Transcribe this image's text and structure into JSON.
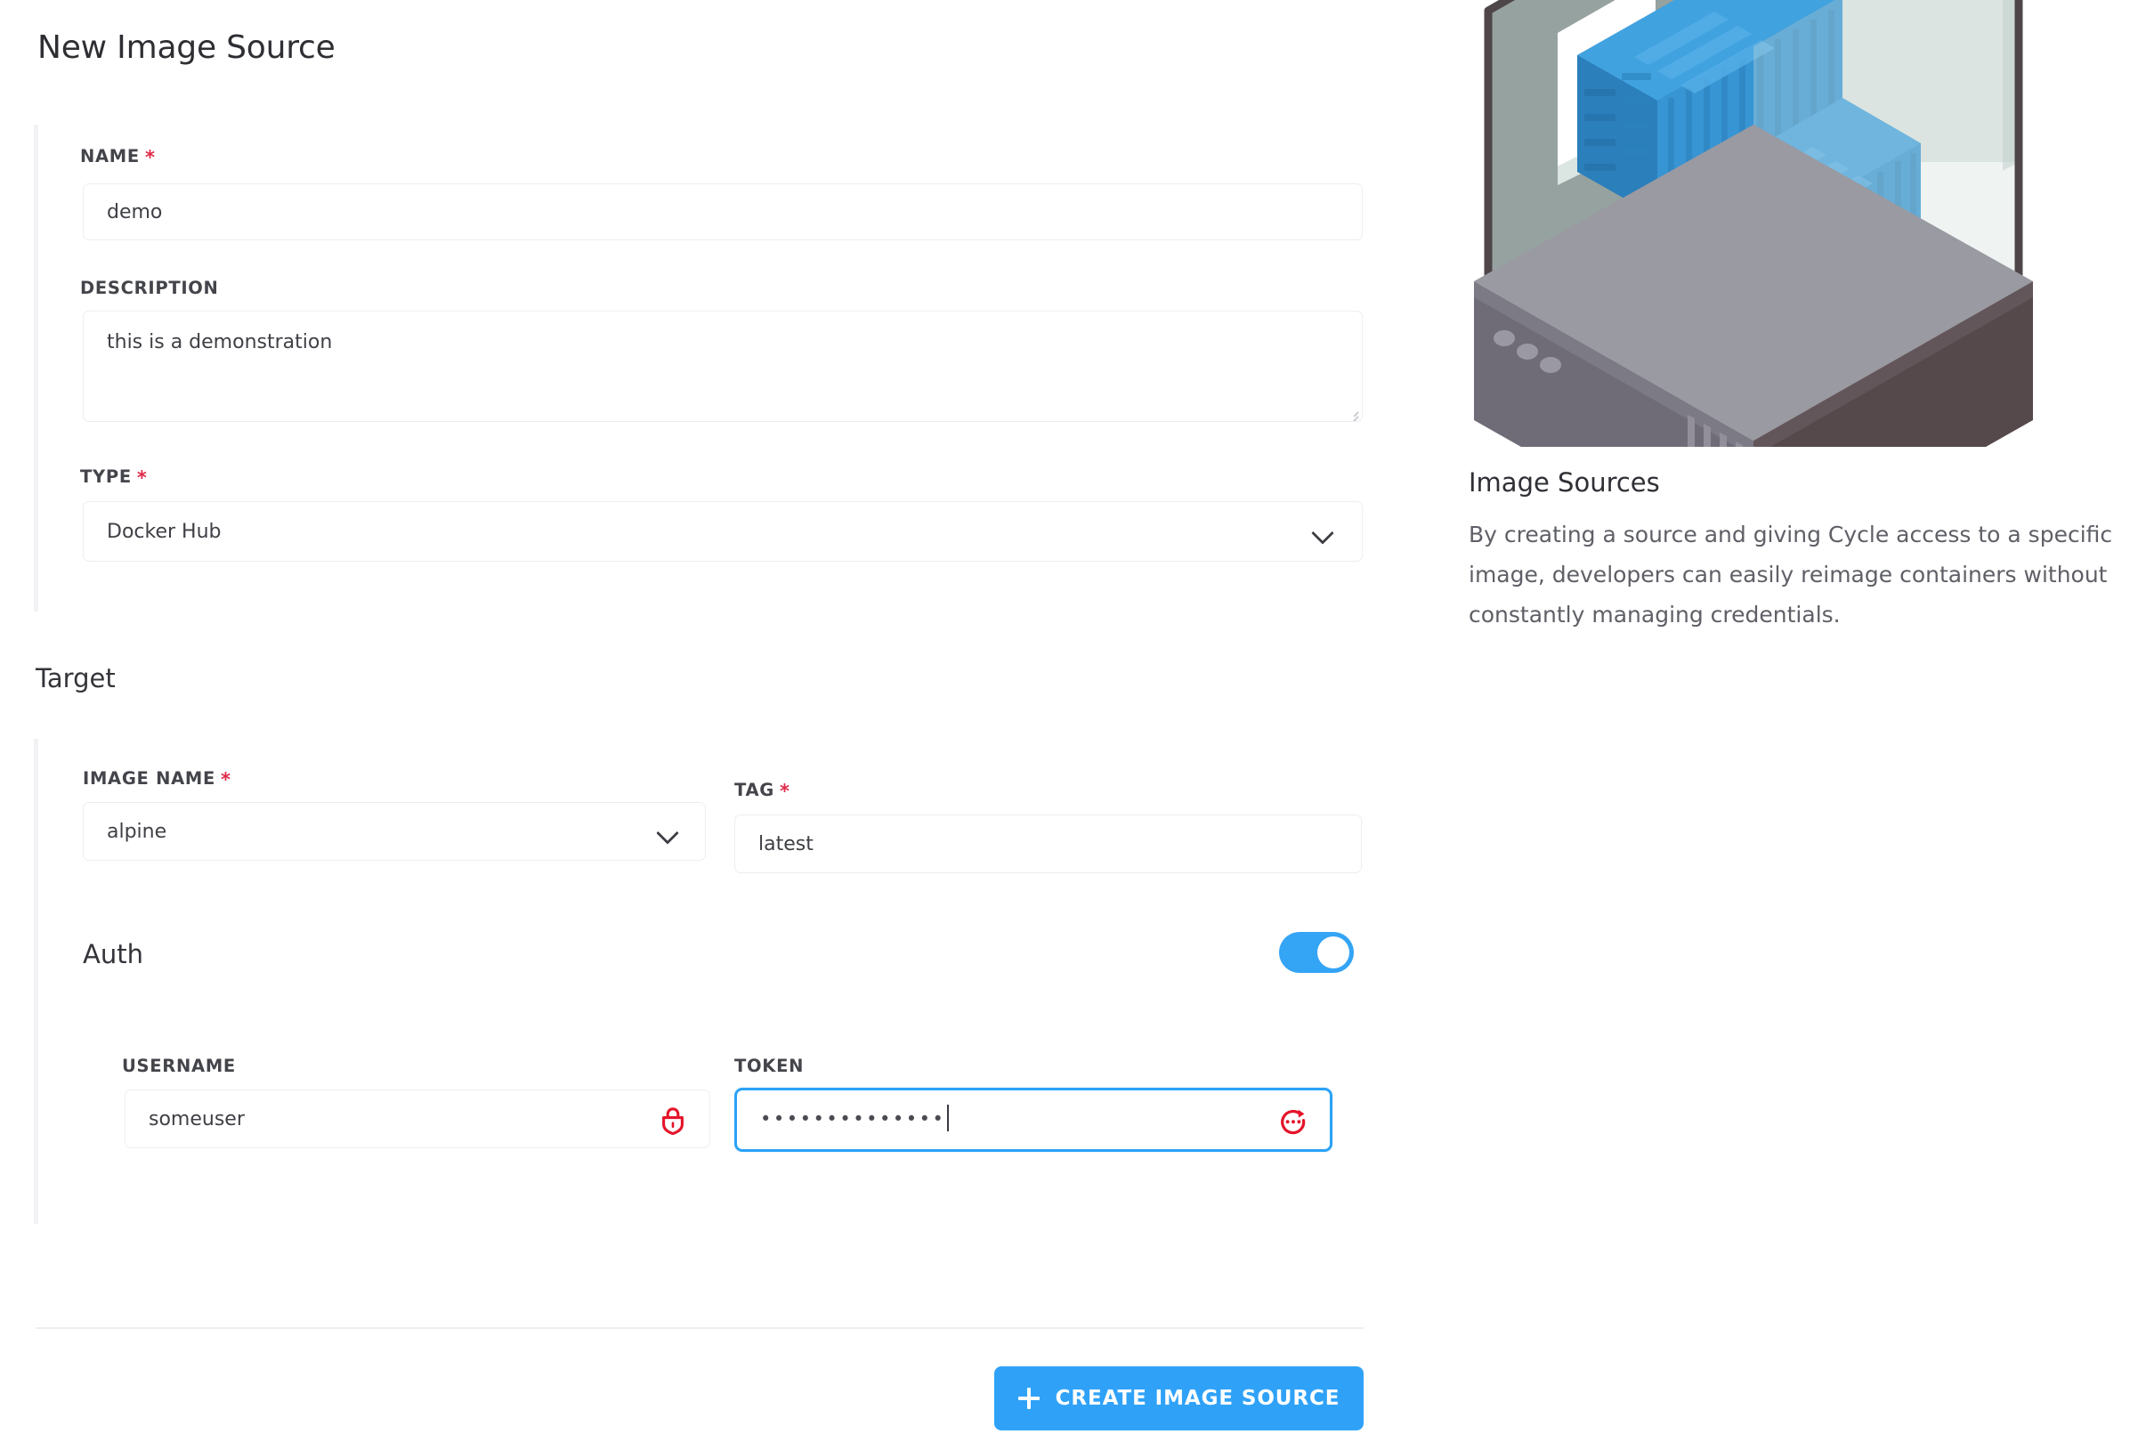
{
  "page": {
    "title": "New Image Source"
  },
  "form": {
    "name": {
      "label": "NAME",
      "required_mark": "*",
      "value": "demo"
    },
    "description": {
      "label": "DESCRIPTION",
      "value": "this is a demonstration"
    },
    "type": {
      "label": "TYPE",
      "required_mark": "*",
      "value": "Docker Hub",
      "icon": "chevron-down-icon"
    }
  },
  "target": {
    "heading": "Target",
    "image_name": {
      "label": "IMAGE NAME",
      "required_mark": "*",
      "value": "alpine",
      "icon": "chevron-down-icon"
    },
    "tag": {
      "label": "TAG",
      "required_mark": "*",
      "value": "latest"
    },
    "auth": {
      "heading": "Auth",
      "toggle_state": "on",
      "toggle_color": "#34a4f5",
      "username": {
        "label": "USERNAME",
        "value": "someuser",
        "icon": "lock-icon",
        "icon_color": "#e5142a"
      },
      "token": {
        "label": "TOKEN",
        "value": "••••••••••••••",
        "masked": true,
        "focused": true,
        "focus_color": "#2ba2f7",
        "icon": "rotate-secret-icon",
        "icon_color": "#e5142a"
      }
    }
  },
  "footer": {
    "create_button": {
      "label": "CREATE IMAGE SOURCE",
      "icon": "plus-icon",
      "color": "#2fa2f8"
    }
  },
  "info_panel": {
    "illustration_name": "isometric-containers-in-glass-case",
    "title": "Image Sources",
    "body": "By creating a source and giving Cycle access to a specific image, developers can easily reimage containers without constantly managing credentials."
  }
}
